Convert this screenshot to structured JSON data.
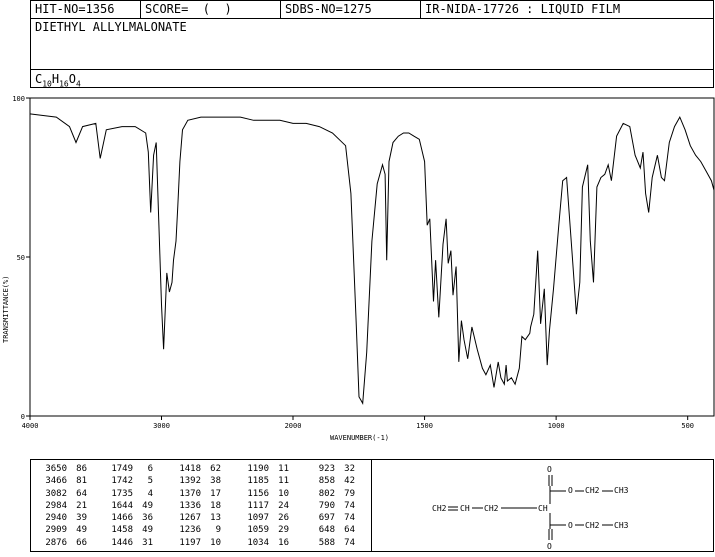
{
  "header": {
    "hit_no": "HIT-NO=1356",
    "score": "SCORE=  (  )",
    "sdbs_no": "SDBS-NO=1275",
    "ir_info": "IR-NIDA-17726 : LIQUID FILM",
    "compound": "DIETHYL ALLYLMALONATE",
    "formula": {
      "C": "10",
      "H": "16",
      "O": "4"
    }
  },
  "chart_data": {
    "type": "line",
    "xlabel": "WAVENUMBER(-1)",
    "ylabel": "TRANSMITTANCE(%)",
    "xlim": [
      4000,
      400
    ],
    "ylim": [
      0,
      100
    ],
    "x_ticks": [
      "4000",
      "3000",
      "2000",
      "1500",
      "1000",
      "500"
    ],
    "y_ticks": [
      "0",
      "50",
      "100"
    ],
    "series": [
      {
        "x": [
          4000,
          3900,
          3800,
          3700,
          3650,
          3600,
          3500,
          3466,
          3420,
          3300,
          3200,
          3120,
          3100,
          3082,
          3060,
          3040,
          3020,
          3000,
          2984,
          2960,
          2940,
          2920,
          2909,
          2890,
          2876,
          2860,
          2840,
          2800,
          2700,
          2600,
          2500,
          2400,
          2300,
          2200,
          2100,
          2000,
          1950,
          1900,
          1850,
          1800,
          1780,
          1760,
          1749,
          1742,
          1735,
          1720,
          1700,
          1680,
          1660,
          1650,
          1644,
          1635,
          1620,
          1600,
          1580,
          1560,
          1540,
          1520,
          1500,
          1490,
          1480,
          1466,
          1458,
          1446,
          1430,
          1418,
          1410,
          1400,
          1392,
          1380,
          1370,
          1360,
          1350,
          1336,
          1320,
          1300,
          1280,
          1267,
          1250,
          1236,
          1220,
          1210,
          1197,
          1190,
          1185,
          1170,
          1156,
          1140,
          1130,
          1117,
          1100,
          1097,
          1085,
          1070,
          1059,
          1045,
          1034,
          1025,
          1010,
          990,
          975,
          960,
          940,
          923,
          910,
          900,
          880,
          870,
          858,
          845,
          830,
          815,
          802,
          790,
          770,
          745,
          720,
          700,
          680,
          670,
          660,
          648,
          635,
          615,
          600,
          588,
          570,
          550,
          530,
          510,
          490,
          470,
          450,
          430,
          410,
          400
        ],
        "y": [
          95,
          94.5,
          94,
          91,
          86,
          91,
          92,
          81,
          90,
          91,
          91,
          89,
          83,
          64,
          82,
          86,
          60,
          35,
          21,
          45,
          39,
          42,
          49,
          55,
          66,
          80,
          90,
          93,
          94,
          94,
          94,
          94,
          93,
          93,
          93,
          92,
          92,
          91,
          89,
          85,
          70,
          30,
          6,
          5,
          4,
          20,
          55,
          73,
          79,
          76,
          49,
          80,
          86,
          88,
          89,
          89,
          88,
          87,
          80,
          60,
          62,
          36,
          49,
          31,
          54,
          62,
          48,
          52,
          38,
          47,
          17,
          30,
          24,
          18,
          28,
          21,
          15,
          13,
          16,
          9,
          17,
          12,
          10,
          16,
          11,
          12,
          10,
          15,
          25,
          24,
          26,
          28,
          32,
          52,
          29,
          40,
          16,
          27,
          40,
          60,
          74,
          75,
          52,
          32,
          42,
          72,
          79,
          55,
          42,
          72,
          75,
          76,
          79,
          74,
          88,
          92,
          91,
          82,
          78,
          83,
          70,
          64,
          75,
          82,
          75,
          74,
          86,
          91,
          94,
          90,
          85,
          82,
          80,
          77,
          74,
          71
        ]
      }
    ],
    "grid": false,
    "peak_table": [
      [
        [
          "3650",
          "86"
        ],
        [
          "3466",
          "81"
        ],
        [
          "3082",
          "64"
        ],
        [
          "2984",
          "21"
        ],
        [
          "2940",
          "39"
        ],
        [
          "2909",
          "49"
        ],
        [
          "2876",
          "66"
        ]
      ],
      [
        [
          "1749",
          "6"
        ],
        [
          "1742",
          "5"
        ],
        [
          "1735",
          "4"
        ],
        [
          "1644",
          "49"
        ],
        [
          "1466",
          "36"
        ],
        [
          "1458",
          "49"
        ],
        [
          "1446",
          "31"
        ]
      ],
      [
        [
          "1418",
          "62"
        ],
        [
          "1392",
          "38"
        ],
        [
          "1370",
          "17"
        ],
        [
          "1336",
          "18"
        ],
        [
          "1267",
          "13"
        ],
        [
          "1236",
          "9"
        ],
        [
          "1197",
          "10"
        ]
      ],
      [
        [
          "1190",
          "11"
        ],
        [
          "1185",
          "11"
        ],
        [
          "1156",
          "10"
        ],
        [
          "1117",
          "24"
        ],
        [
          "1097",
          "26"
        ],
        [
          "1059",
          "29"
        ],
        [
          "1034",
          "16"
        ]
      ],
      [
        [
          "923",
          "32"
        ],
        [
          "858",
          "42"
        ],
        [
          "802",
          "79"
        ],
        [
          "790",
          "74"
        ],
        [
          "697",
          "74"
        ],
        [
          "648",
          "64"
        ],
        [
          "588",
          "74"
        ]
      ]
    ],
    "structure_labels": {
      "o_top": "O",
      "o_bottom": "O",
      "ch2_left": "CH2",
      "ch": "CH",
      "ch2_mid": "CH2",
      "ch_center": "CH",
      "o_ester_top": "O",
      "ch2_top": "CH2",
      "ch3_top": "CH3",
      "o_ester_bottom": "O",
      "ch2_bottom": "CH2",
      "ch3_bottom": "CH3"
    }
  }
}
